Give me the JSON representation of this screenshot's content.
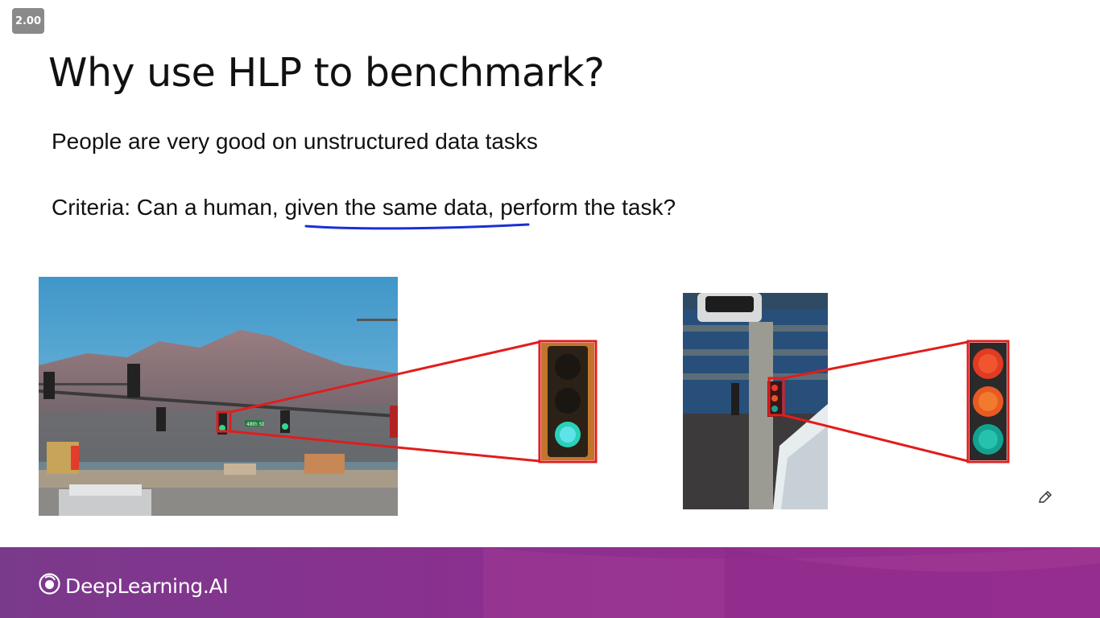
{
  "player": {
    "speed_label": "2.00"
  },
  "slide": {
    "title": "Why use HLP to benchmark?",
    "bullet_1": "People are very good on unstructured data tasks",
    "bullet_2_prefix": "Criteria: Can a human, ",
    "bullet_2_underlined": "given the same data,",
    "bullet_2_suffix": " perform the task?",
    "underline_color": "#1a2fd6",
    "callout_color": "#e11d1d",
    "images": [
      {
        "name": "traffic-light-green-mountain-scene",
        "light_state": "green"
      },
      {
        "name": "traffic-light-red-city-scene",
        "light_state": "red-orange-green"
      }
    ],
    "signs": {
      "street_sign_text": "48th St"
    }
  },
  "footer": {
    "brand": "DeepLearning.AI",
    "color_start": "#7a3a8c",
    "color_end": "#9a2e8e"
  },
  "icons": [
    "pencil-icon",
    "deeplearning-logo-icon"
  ]
}
